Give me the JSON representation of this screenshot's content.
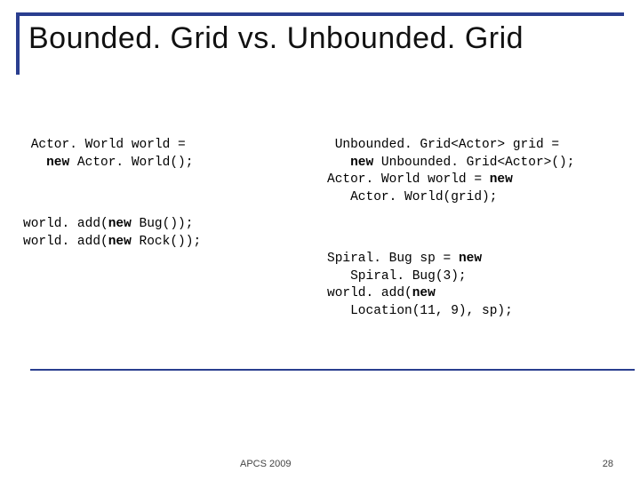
{
  "title": "Bounded. Grid vs. Unbounded. Grid",
  "left": {
    "block1_l1": "Actor. World world =",
    "block1_l2": "new",
    "block1_l3": " Actor. World();",
    "block2_l1": "world. add(",
    "block2_l2": "new",
    "block2_l3": " Bug());",
    "block2_l4": "world. add(",
    "block2_l5": "new",
    "block2_l6": " Rock());"
  },
  "right": {
    "block1_l1": "Unbounded. Grid<Actor> grid =",
    "block1_l2": "new",
    "block1_l3": " Unbounded. Grid<Actor>();",
    "block1_l4": "Actor. World world = ",
    "block1_l5": "new",
    "block1_l6": "Actor. World(grid);",
    "block2_l1": "Spiral. Bug sp = ",
    "block2_l2": "new",
    "block2_l3": "Spiral. Bug(3);",
    "block2_l4": "world. add(",
    "block2_l5": "new",
    "block2_l6": "Location(11, 9), sp);"
  },
  "footer": {
    "center": "APCS 2009",
    "page": "28"
  }
}
